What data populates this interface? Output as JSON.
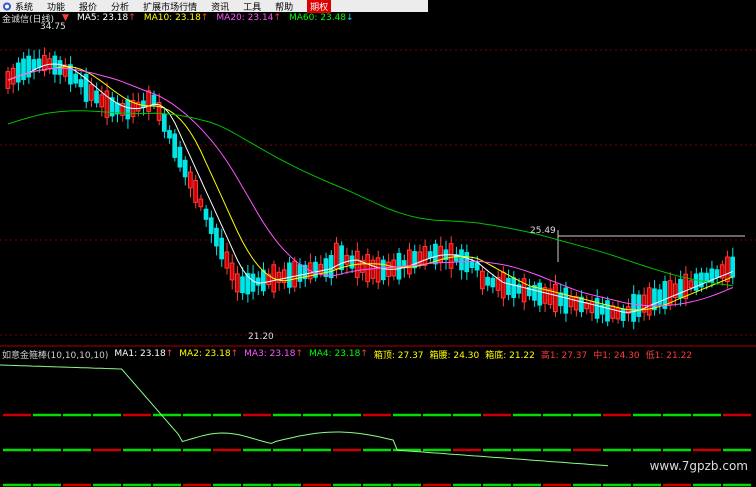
{
  "menu": {
    "items": [
      "系统",
      "功能",
      "报价",
      "分析",
      "扩展市场行情",
      "资讯",
      "工具",
      "帮助"
    ],
    "active": "期权"
  },
  "header": {
    "title": "金诚信(日线)",
    "ma": [
      {
        "label": "MA5: 23.18",
        "arrow": "↑",
        "color": "#ffffff"
      },
      {
        "label": "MA10: 23.18",
        "arrow": "↑",
        "color": "#ffff00"
      },
      {
        "label": "MA20: 23.14",
        "arrow": "↑",
        "color": "#ff55ff"
      },
      {
        "label": "MA60: 23.48",
        "arrow": "↓",
        "color": "#00ff00"
      }
    ]
  },
  "price_labels": {
    "high": "34.75",
    "low": "21.20",
    "mid": "25.49"
  },
  "indicator": {
    "name": "如意金箍棒(10,10,10,10)",
    "items": [
      {
        "label": "MA1: 23.18",
        "arrow": "↑",
        "color": "#ffffff"
      },
      {
        "label": "MA2: 23.18",
        "arrow": "↑",
        "color": "#ffff00"
      },
      {
        "label": "MA3: 23.18",
        "arrow": "↑",
        "color": "#ff55ff"
      },
      {
        "label": "MA4: 23.18",
        "arrow": "↑",
        "color": "#00ff00"
      },
      {
        "label": "箱顶: 27.37",
        "arrow": "",
        "color": "#ffff00"
      },
      {
        "label": "箱腰: 24.30",
        "arrow": "",
        "color": "#ffff00"
      },
      {
        "label": "箱底: 21.22",
        "arrow": "",
        "color": "#ffff00"
      },
      {
        "label": "高1: 27.37",
        "arrow": "",
        "color": "#ff3b3b"
      },
      {
        "label": "中1: 24.30",
        "arrow": "",
        "color": "#ff3b3b"
      },
      {
        "label": "低1: 21.22",
        "arrow": "",
        "color": "#ff3b3b"
      }
    ]
  },
  "watermark": "www.7gpzb.com",
  "colors": {
    "up": "#ff3b3b",
    "down": "#00e5e5",
    "grid": "#7a0000",
    "ma5": "#ffffff",
    "ma10": "#ffff00",
    "ma20": "#ff55ff",
    "ma60": "#00c000"
  }
}
